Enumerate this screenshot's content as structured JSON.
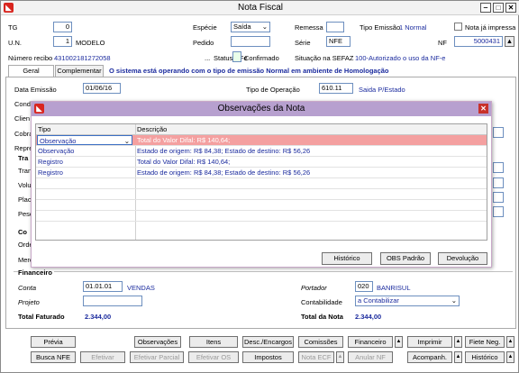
{
  "window": {
    "title": "Nota Fiscal",
    "minimize": "‒",
    "maximize": "□",
    "close": "✕"
  },
  "header": {
    "tg_label": "TG",
    "tg_value": "0",
    "un_label": "U.N.",
    "un_value": "1",
    "un_name": "MODELO",
    "recibo_label": "Número recibo",
    "recibo_value": "431002181272058",
    "especie_label": "Espécie",
    "especie_value": "Saída",
    "pedido_label": "Pedido",
    "status_dots": "...",
    "status_label": "Status NFe",
    "status_value": "Confirmado",
    "remessa_label": "Remessa",
    "serie_label": "Série",
    "serie_value": "NFE",
    "sefaz_label": "Situação na SEFAZ",
    "sefaz_value": "100-Autorizado o uso da NF-e",
    "tipo_emissao_label": "Tipo Emissão",
    "tipo_emissao_value": "1 Normal",
    "nf_label": "NF",
    "nf_value": "5000431",
    "ja_impressa_label": "Nota já impressa"
  },
  "tabs": [
    {
      "label": "Geral"
    },
    {
      "label": "Complementar"
    }
  ],
  "emission_notice": "O sistema está operando com o tipo de emissão Normal em ambiente de Homologação",
  "geral": {
    "data_emissao_label": "Data Emissão",
    "data_emissao_value": "01/06/16",
    "tipo_operacao_label": "Tipo de Operação",
    "tipo_operacao_code": "610.11",
    "tipo_operacao_desc": "Saida P/Estado",
    "cond_label": "Cond",
    "clien_label": "Clien",
    "cobra_label": "Cobra",
    "repre_label": "Repre",
    "tra_label": "Tra",
    "tran_label": "Tran",
    "volu_label": "Volu",
    "placa_label": "Placa",
    "peso_label": "Peso",
    "co_label": "Co",
    "orde_label": "Orde",
    "merc_label": "Merc",
    "financeiro_label": "Financeiro",
    "conta_label": "Conta",
    "conta_value": "01.01.01",
    "conta_desc": "VENDAS",
    "projeto_label": "Projeto",
    "portador_label": "Portador",
    "portador_value": "020",
    "portador_desc": "BANRISUL",
    "contabilidade_label": "Contabilidade",
    "contabilidade_value": "a Contabilizar",
    "total_faturado_label": "Total Faturado",
    "total_faturado_value": "2.344,00",
    "total_nota_label": "Total da Nota",
    "total_nota_value": "2.344,00"
  },
  "dialog": {
    "title": "Observações da Nota",
    "close": "✕",
    "columns": [
      "Tipo",
      "Descrição"
    ],
    "rows": [
      {
        "tipo": "Observação",
        "descricao": "Total do Valor Difal: R$ 140,64;"
      },
      {
        "tipo": "Observação",
        "descricao": "Estado de origem: R$ 84,38; Estado de destino: R$ 56,26"
      },
      {
        "tipo": "Registro",
        "descricao": "Total do Valor Difal: R$ 140,64;"
      },
      {
        "tipo": "Registro",
        "descricao": "Estado de origem: R$ 84,38; Estado de destino: R$ 56,26"
      }
    ],
    "buttons": {
      "historico": "Histórico",
      "obs_padrao": "OBS Padrão",
      "devolucao": "Devolução"
    }
  },
  "toolbar": {
    "previa": "Prévia",
    "observacoes": "Observações",
    "itens": "Itens",
    "desc_encargos": "Desc./Encargos",
    "comissoes": "Comissões",
    "financeiro": "Financeiro",
    "imprimir": "Imprimir",
    "fiete_neg": "Fiete Neg.",
    "busca_nfe": "Busca NFE",
    "efetivar": "Efetivar",
    "efetivar_parcial": "Efetivar Parcial",
    "efetivar_os": "Efetivar OS",
    "impostos": "Impostos",
    "nota_ecf": "Nota ECF",
    "anular_nf": "Anular NF",
    "acompanh": "Acompanh.",
    "historico": "Histórico"
  },
  "colors": {
    "dialog_title": "#b7a0cf",
    "selected_row": "#f4a0a0",
    "accent_blue": "#1b2b9e"
  }
}
